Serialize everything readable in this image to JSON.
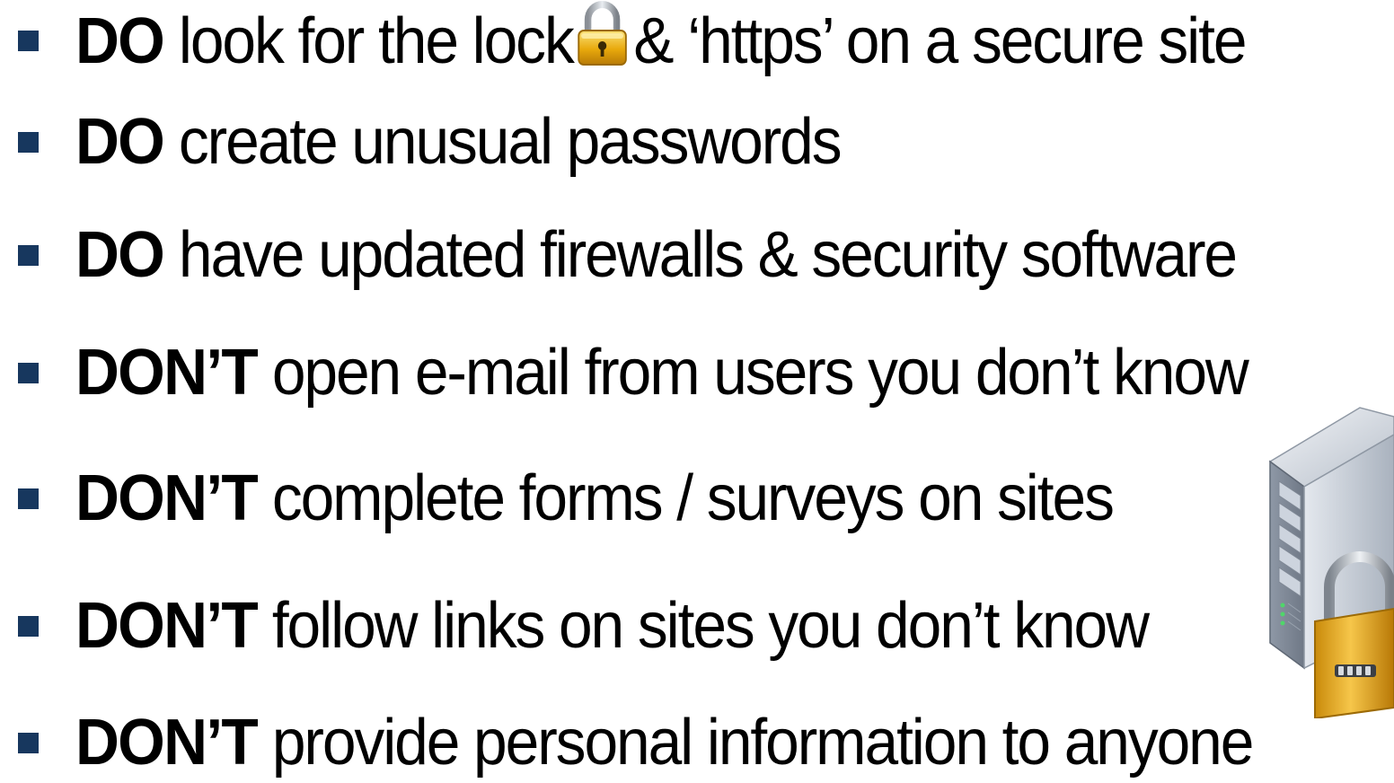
{
  "colors": {
    "bullet": "#17375e",
    "text": "#000000",
    "lock_gold": "#e8a90c",
    "server_body": "#c5ccd6"
  },
  "icons": {
    "inline_lock": "padlock-icon",
    "decoration": "server-with-padlock-icon"
  },
  "items": [
    {
      "keyword": "DO",
      "pre": " look for the lock",
      "post": "& ‘https’ on a secure site"
    },
    {
      "keyword": "DO",
      "text": " create unusual passwords"
    },
    {
      "keyword": "DO",
      "text": " have updated firewalls & security software"
    },
    {
      "keyword": "DON’T",
      "text": " open e-mail from users you don’t know"
    },
    {
      "keyword": "DON’T",
      "text": " complete forms / surveys on sites"
    },
    {
      "keyword": "DON’T",
      "text": " follow links on sites you don’t know"
    },
    {
      "keyword": "DON’T",
      "text": " provide personal information to anyone"
    }
  ]
}
